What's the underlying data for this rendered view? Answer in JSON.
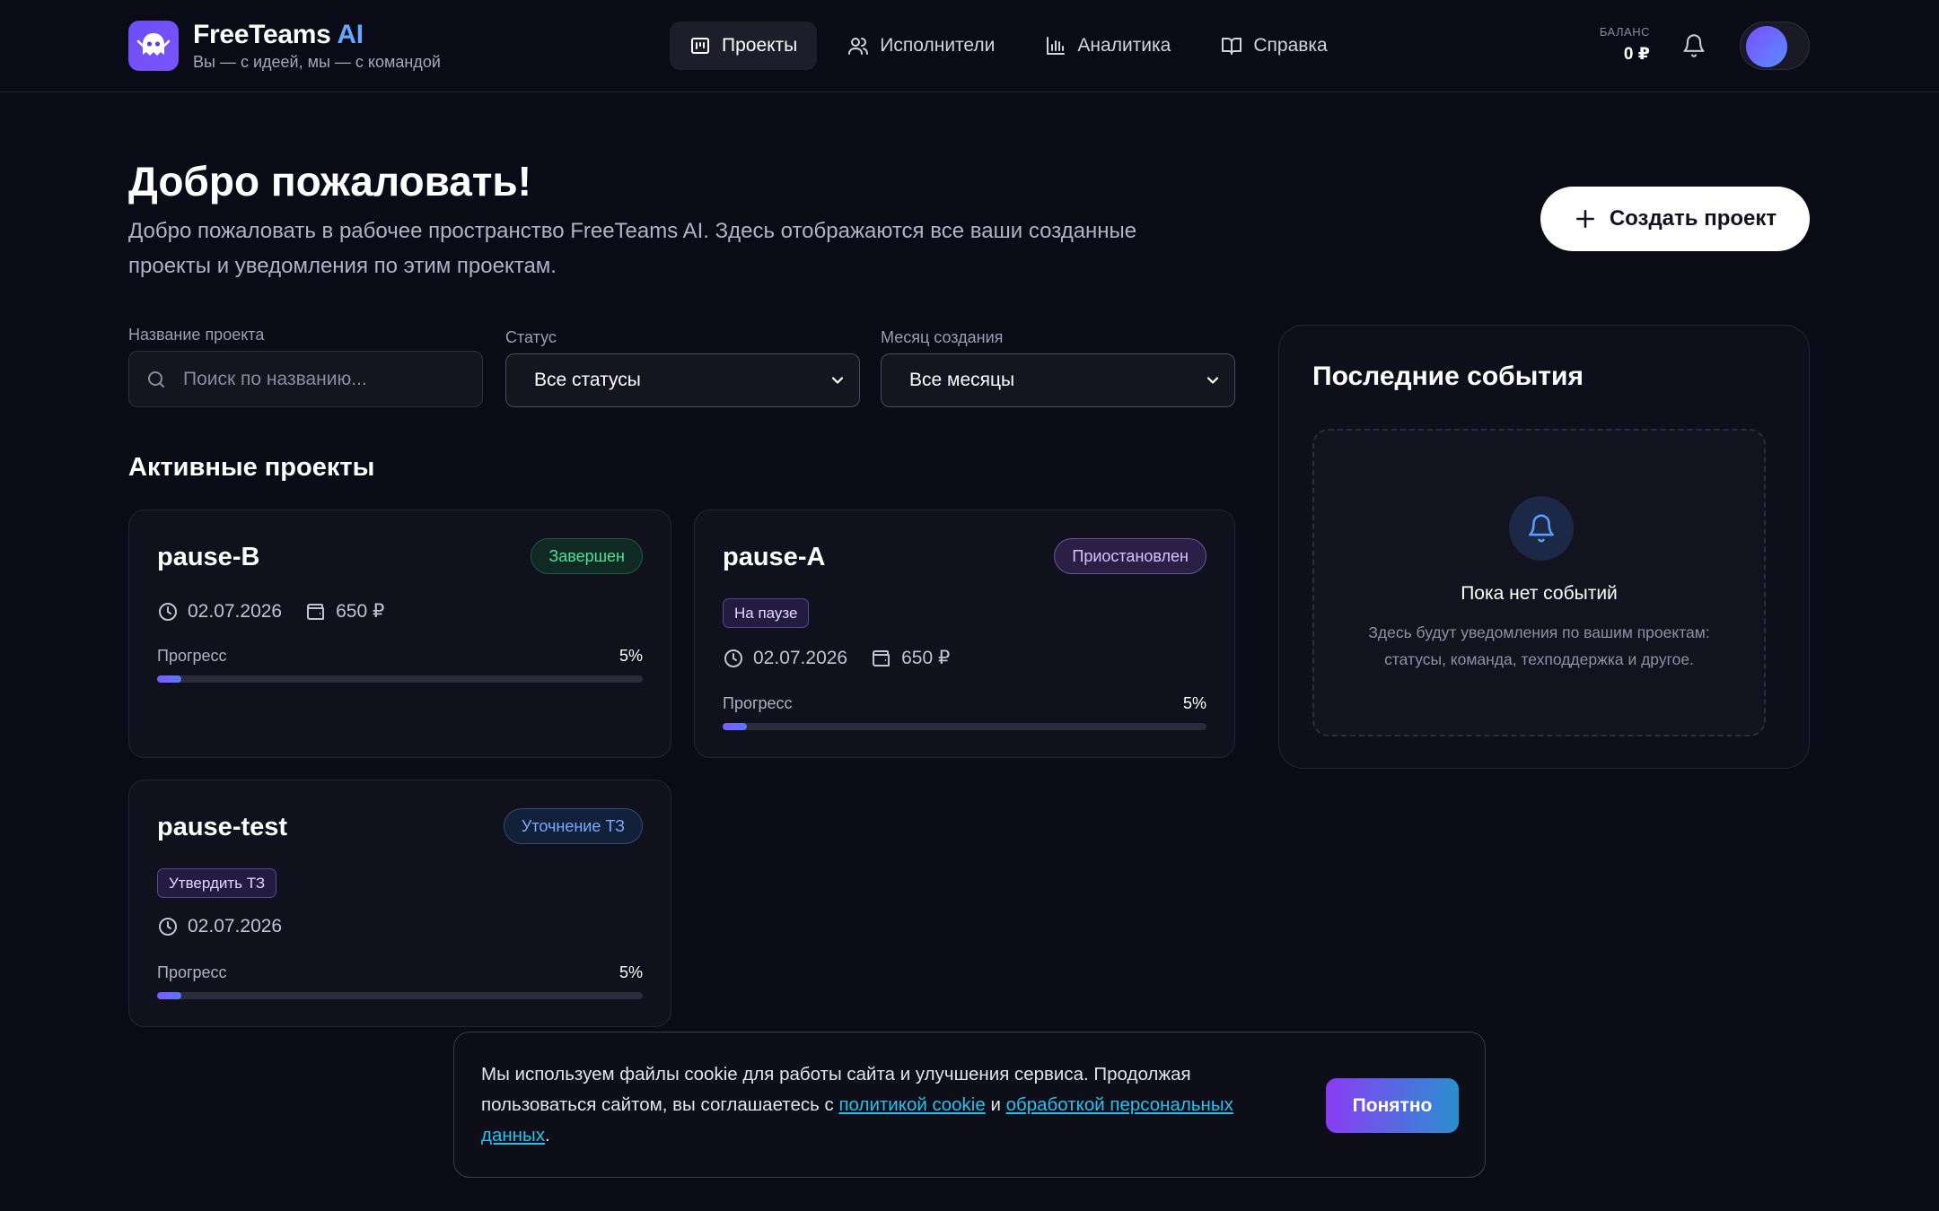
{
  "brand": {
    "name": "FreeTeams",
    "name_ai": "AI",
    "tagline": "Вы — с идеей, мы — с командой",
    "logo_color": "#6a4cf6"
  },
  "nav": {
    "items": [
      {
        "label": "Проекты",
        "icon": "projects-icon",
        "active": true
      },
      {
        "label": "Исполнители",
        "icon": "users-icon",
        "active": false
      },
      {
        "label": "Аналитика",
        "icon": "chart-icon",
        "active": false
      },
      {
        "label": "Справка",
        "icon": "book-icon",
        "active": false
      }
    ]
  },
  "account": {
    "balance_label": "БАЛАНС",
    "balance_value": "0 ₽"
  },
  "hero": {
    "title": "Добро пожаловать!",
    "description": "Добро пожаловать в рабочее пространство FreeTeams AI. Здесь отображаются все ваши созданные проекты и уведомления по этим проектам.",
    "create_button": "Создать проект"
  },
  "filters": {
    "name_label": "Название проекта",
    "search_placeholder": "Поиск по названию...",
    "status_label": "Статус",
    "status_value": "Все статусы",
    "month_label": "Месяц создания",
    "month_value": "Все месяцы"
  },
  "projects": {
    "section_title": "Активные проекты",
    "progress_label": "Прогресс",
    "items": [
      {
        "title": "pause-B",
        "status": "Завершен",
        "status_color": "#4ee0a0",
        "date": "02.07.2026",
        "price": "650 ₽",
        "progress": 5,
        "progress_text": "5%"
      },
      {
        "title": "pause-A",
        "status": "Приостановлен",
        "status_color": "#d5c5ff",
        "tag": "На паузе",
        "date": "02.07.2026",
        "price": "650 ₽",
        "progress": 5,
        "progress_text": "5%"
      },
      {
        "title": "pause-test",
        "status": "Уточнение ТЗ",
        "status_color": "#7aaaff",
        "tag": "Утвердить ТЗ",
        "date": "02.07.2026",
        "progress": 5,
        "progress_text": "5%"
      }
    ]
  },
  "events": {
    "title": "Последние события",
    "empty_title": "Пока нет событий",
    "empty_text": "Здесь будут уведомления по вашим проектам: статусы, команда, техподдержка и другое."
  },
  "cookie": {
    "text_before": "Мы используем файлы cookie для работы сайта и улучшения сервиса. Продолжая пользоваться сайтом, вы соглашаетесь с ",
    "link1": "политикой cookie",
    "text_middle": " и ",
    "link2": "обработкой персональных данных",
    "text_after": ".",
    "button": "Понятно"
  }
}
